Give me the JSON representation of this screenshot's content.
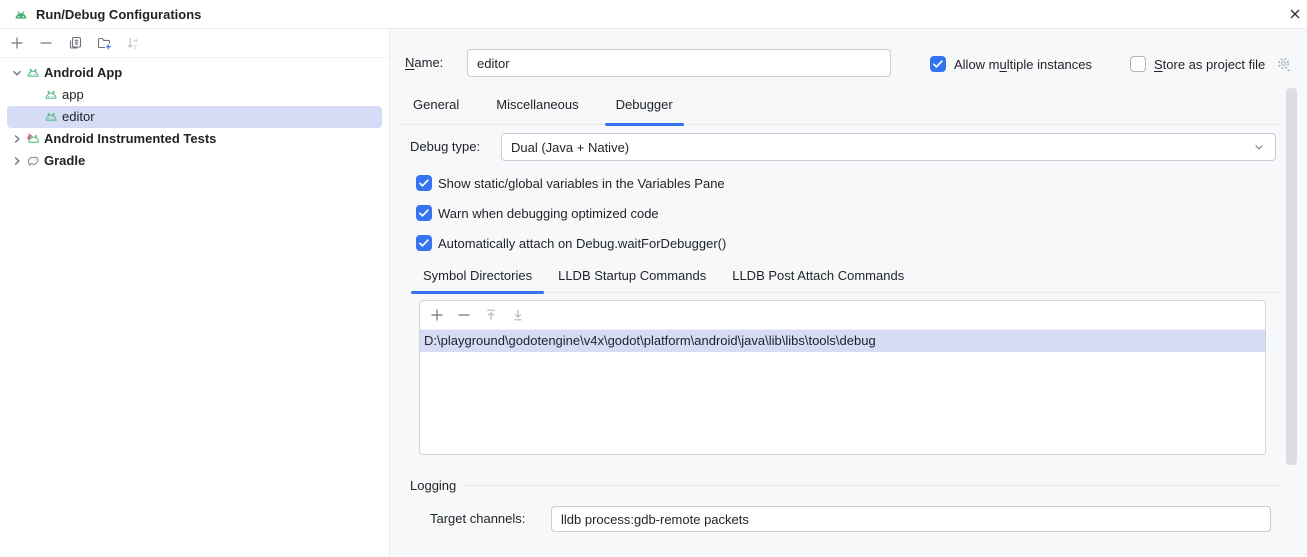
{
  "window": {
    "title": "Run/Debug Configurations"
  },
  "sidebar": {
    "toolbar_icons": [
      "add-icon",
      "remove-icon",
      "copy-icon",
      "new-folder-icon",
      "sort-icon"
    ],
    "tree": [
      {
        "label": "Android App"
      },
      {
        "label": "app"
      },
      {
        "label": "editor"
      },
      {
        "label": "Android Instrumented Tests"
      },
      {
        "label": "Gradle"
      }
    ]
  },
  "form": {
    "name": {
      "mnemonic": "N",
      "rest": "ame:",
      "value": "editor"
    },
    "allow_multiple": {
      "pre": "Allow m",
      "mnemonic": "u",
      "post": "ltiple instances",
      "checked": true
    },
    "store_as_project": {
      "mnemonic": "S",
      "rest": "tore as project file",
      "checked": false
    },
    "tabs": [
      {
        "label": "General"
      },
      {
        "label": "Miscellaneous"
      },
      {
        "label": "Debugger"
      }
    ],
    "active_tab": "Debugger"
  },
  "debugger": {
    "debug_type_label": "Debug type:",
    "debug_type_value": "Dual (Java + Native)",
    "options": [
      {
        "label": "Show static/global variables in the Variables Pane",
        "checked": true
      },
      {
        "label": "Warn when debugging optimized code",
        "checked": true
      },
      {
        "label": "Automatically attach on Debug.waitForDebugger()",
        "checked": true
      }
    ],
    "subtabs": [
      {
        "label": "Symbol Directories"
      },
      {
        "label": "LLDB Startup Commands"
      },
      {
        "label": "LLDB Post Attach Commands"
      }
    ],
    "active_subtab": "Symbol Directories",
    "dir_toolbar_icons": [
      "add-icon",
      "remove-icon",
      "move-up-icon",
      "move-down-icon"
    ],
    "symbol_directories": [
      "D:\\playground\\godotengine\\v4x\\godot\\platform\\android\\java\\lib\\libs\\tools\\debug"
    ],
    "logging": {
      "section_label": "Logging",
      "target_channels_label": "Target channels:",
      "target_channels_value": "lldb process:gdb-remote packets"
    }
  },
  "colors": {
    "accent_blue": "#3574f0",
    "selection": "#d6dcf6",
    "android_green": "#5fbf8b",
    "panel_bg": "#f7f8fa"
  }
}
